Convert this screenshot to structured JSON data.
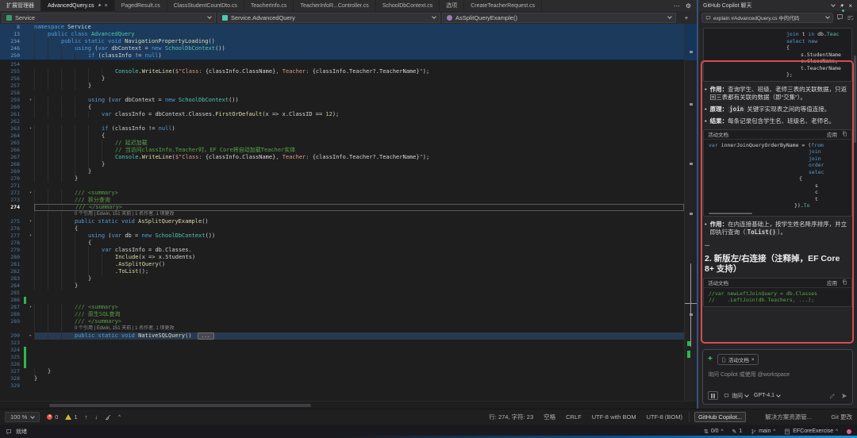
{
  "tabs": {
    "items": [
      {
        "label": "扩展管理器",
        "shade": true
      },
      {
        "label": "AdvancedQuery.cs",
        "active": true,
        "pinned": true,
        "closable": true
      },
      {
        "label": "PagedResult.cs"
      },
      {
        "label": "ClassStudentCountDto.cs"
      },
      {
        "label": "TeacherInfo.cs"
      },
      {
        "label": "TeacherInfoR...Controller.cs"
      },
      {
        "label": "SchoolDbContext.cs"
      },
      {
        "label": "选项"
      },
      {
        "label": "CreateTeacherRequest.cs"
      }
    ],
    "overflow": "⋯"
  },
  "breadcrumb": {
    "project": "Service",
    "type": "Service.AdvancedQuery",
    "member": "AsSplitQueryExample()"
  },
  "editor": {
    "sticky_lines": [
      {
        "n": "8",
        "i": 0,
        "seg": [
          [
            "k",
            "namespace"
          ],
          [
            "p",
            " Service"
          ]
        ]
      },
      {
        "n": "13",
        "i": 1,
        "seg": [
          [
            "k",
            "public"
          ],
          [
            "p",
            " "
          ],
          [
            "k",
            "class"
          ],
          [
            "p",
            " "
          ],
          [
            "t",
            "AdvancedQuery"
          ]
        ]
      },
      {
        "n": "234",
        "i": 2,
        "seg": [
          [
            "k",
            "public"
          ],
          [
            "p",
            " "
          ],
          [
            "k",
            "static"
          ],
          [
            "p",
            " "
          ],
          [
            "k",
            "void"
          ],
          [
            "p",
            " "
          ],
          [
            "m",
            "NavigationPropertyLoading"
          ],
          [
            "p",
            "()"
          ]
        ]
      },
      {
        "n": "246",
        "i": 3,
        "seg": [
          [
            "k",
            "using"
          ],
          [
            "p",
            " ("
          ],
          [
            "k",
            "var"
          ],
          [
            "p",
            " dbContext = "
          ],
          [
            "k",
            "new"
          ],
          [
            "p",
            " "
          ],
          [
            "t",
            "SchoolDbContext"
          ],
          [
            "p",
            "())"
          ]
        ]
      },
      {
        "n": "250",
        "i": 4,
        "seg": [
          [
            "k",
            "if"
          ],
          [
            "p",
            " (classInfo != "
          ],
          [
            "k",
            "null"
          ],
          [
            "p",
            ")"
          ]
        ]
      }
    ],
    "lines": [
      {
        "n": "254",
        "i": 0,
        "seg": []
      },
      {
        "n": "255",
        "i": 6,
        "seg": [
          [
            "t",
            "Console"
          ],
          [
            "p",
            "."
          ],
          [
            "m",
            "WriteLine"
          ],
          [
            "p",
            "("
          ],
          [
            "s",
            "$\"Class: "
          ],
          [
            "p",
            "{classInfo.ClassName}"
          ],
          [
            "s",
            ", Teacher: "
          ],
          [
            "p",
            "{classInfo.Teacher?.TeacherName}"
          ],
          [
            "s",
            "\""
          ],
          [
            "p",
            ");"
          ]
        ]
      },
      {
        "n": "256",
        "i": 5,
        "seg": [
          [
            "p",
            "}"
          ]
        ]
      },
      {
        "n": "257",
        "i": 4,
        "seg": [
          [
            "p",
            "}"
          ]
        ]
      },
      {
        "n": "258",
        "i": 0,
        "seg": []
      },
      {
        "n": "259",
        "i": 4,
        "fold": "v",
        "seg": [
          [
            "k",
            "using"
          ],
          [
            "p",
            " ("
          ],
          [
            "k",
            "var"
          ],
          [
            "p",
            " dbContext = "
          ],
          [
            "k",
            "new"
          ],
          [
            "p",
            " "
          ],
          [
            "t",
            "SchoolDbContext"
          ],
          [
            "p",
            "())"
          ]
        ]
      },
      {
        "n": "260",
        "i": 4,
        "seg": [
          [
            "p",
            "{"
          ]
        ]
      },
      {
        "n": "261",
        "i": 5,
        "seg": [
          [
            "k",
            "var"
          ],
          [
            "p",
            " classInfo = dbContext.Classes."
          ],
          [
            "m",
            "FirstOrDefault"
          ],
          [
            "p",
            "(x => x.ClassID == "
          ],
          [
            "n2",
            "12"
          ],
          [
            "p",
            ");"
          ]
        ]
      },
      {
        "n": "262",
        "i": 0,
        "seg": []
      },
      {
        "n": "263",
        "i": 5,
        "fold": "v",
        "seg": [
          [
            "k",
            "if"
          ],
          [
            "p",
            " (classInfo != "
          ],
          [
            "k",
            "null"
          ],
          [
            "p",
            ")"
          ]
        ]
      },
      {
        "n": "264",
        "i": 5,
        "seg": [
          [
            "p",
            "{"
          ]
        ]
      },
      {
        "n": "265",
        "i": 6,
        "seg": [
          [
            "c",
            "// 延迟加载"
          ]
        ]
      },
      {
        "n": "266",
        "i": 6,
        "seg": [
          [
            "c",
            "// 当访问classInfo.Teacher时，EF Core将自动加载Teacher实体"
          ]
        ]
      },
      {
        "n": "267",
        "i": 6,
        "seg": [
          [
            "t",
            "Console"
          ],
          [
            "p",
            "."
          ],
          [
            "m",
            "WriteLine"
          ],
          [
            "p",
            "("
          ],
          [
            "s",
            "$\"Class: "
          ],
          [
            "p",
            "{classInfo.ClassName}"
          ],
          [
            "s",
            ", Teacher: "
          ],
          [
            "p",
            "{classInfo.Teacher?.TeacherName}"
          ],
          [
            "s",
            "\""
          ],
          [
            "p",
            ");"
          ]
        ]
      },
      {
        "n": "268",
        "i": 5,
        "seg": [
          [
            "p",
            "}"
          ]
        ]
      },
      {
        "n": "269",
        "i": 4,
        "seg": [
          [
            "p",
            "}"
          ]
        ]
      },
      {
        "n": "270",
        "i": 3,
        "seg": [
          [
            "p",
            "}"
          ]
        ]
      },
      {
        "n": "271",
        "i": 0,
        "seg": []
      },
      {
        "n": "272",
        "i": 3,
        "fold": "v",
        "seg": [
          [
            "d",
            "/// <summary>"
          ]
        ]
      },
      {
        "n": "273",
        "i": 3,
        "seg": [
          [
            "d",
            "/// 拆分查询"
          ]
        ]
      },
      {
        "n": "274",
        "i": 3,
        "cur": true,
        "seg": [
          [
            "d",
            "/// </summary>"
          ]
        ]
      },
      {
        "lens": true,
        "i": 3,
        "text": "0 个引用 | Edwin, 151 天前 | 1 名作者, 1 项更改"
      },
      {
        "n": "275",
        "i": 3,
        "fold": "v",
        "seg": [
          [
            "k",
            "public"
          ],
          [
            "p",
            " "
          ],
          [
            "k",
            "static"
          ],
          [
            "p",
            " "
          ],
          [
            "k",
            "void"
          ],
          [
            "p",
            " "
          ],
          [
            "m",
            "AsSplitQueryExample"
          ],
          [
            "p",
            "()"
          ]
        ]
      },
      {
        "n": "276",
        "i": 3,
        "seg": [
          [
            "p",
            "{"
          ]
        ]
      },
      {
        "n": "277",
        "i": 4,
        "fold": "v",
        "seg": [
          [
            "k",
            "using"
          ],
          [
            "p",
            " ("
          ],
          [
            "k",
            "var"
          ],
          [
            "p",
            " db = "
          ],
          [
            "k",
            "new"
          ],
          [
            "p",
            " "
          ],
          [
            "t",
            "SchoolDbContext"
          ],
          [
            "p",
            "())"
          ]
        ]
      },
      {
        "n": "278",
        "i": 4,
        "seg": [
          [
            "p",
            "{"
          ]
        ]
      },
      {
        "n": "279",
        "i": 5,
        "seg": [
          [
            "k",
            "var"
          ],
          [
            "p",
            " classInfo = db.Classes."
          ]
        ]
      },
      {
        "n": "280",
        "i": 6,
        "seg": [
          [
            "m",
            "Include"
          ],
          [
            "p",
            "(x => x.Students)"
          ]
        ]
      },
      {
        "n": "281",
        "i": 6,
        "seg": [
          [
            "p",
            "."
          ],
          [
            "m",
            "AsSplitQuery"
          ],
          [
            "p",
            "()"
          ]
        ]
      },
      {
        "n": "282",
        "i": 6,
        "seg": [
          [
            "p",
            "."
          ],
          [
            "m",
            "ToList"
          ],
          [
            "p",
            "();"
          ]
        ]
      },
      {
        "n": "283",
        "i": 4,
        "seg": [
          [
            "p",
            "}"
          ]
        ]
      },
      {
        "n": "284",
        "i": 3,
        "seg": [
          [
            "p",
            "}"
          ]
        ]
      },
      {
        "n": "285",
        "i": 0,
        "seg": []
      },
      {
        "n": "286",
        "i": 0,
        "chg": true,
        "seg": []
      },
      {
        "n": "287",
        "i": 3,
        "fold": "v",
        "seg": [
          [
            "d",
            "/// <summary>"
          ]
        ]
      },
      {
        "n": "288",
        "i": 3,
        "seg": [
          [
            "d",
            "/// 原生SQL查询"
          ]
        ]
      },
      {
        "n": "289",
        "i": 3,
        "seg": [
          [
            "d",
            "/// </summary>"
          ]
        ]
      },
      {
        "lens": true,
        "i": 3,
        "text": "0 个引用 | Edwin, 151 天前 | 1 名作者, 1 项更改"
      },
      {
        "n": "290",
        "i": 3,
        "fold": ">",
        "hl": true,
        "seg": [
          [
            "k",
            "public"
          ],
          [
            "p",
            " "
          ],
          [
            "k",
            "static"
          ],
          [
            "p",
            " "
          ],
          [
            "k",
            "void"
          ],
          [
            "p",
            " "
          ],
          [
            "m",
            "NativeSQLQuery"
          ],
          [
            "p",
            "() "
          ],
          [
            "box",
            "..."
          ]
        ]
      },
      {
        "n": "323",
        "i": 0,
        "seg": []
      },
      {
        "n": "324",
        "i": 0,
        "chg": true,
        "seg": []
      },
      {
        "n": "325",
        "i": 0,
        "chg": true,
        "seg": []
      },
      {
        "n": "326",
        "i": 0,
        "chg": true,
        "seg": []
      },
      {
        "n": "327",
        "i": 1,
        "seg": [
          [
            "p",
            "}"
          ]
        ]
      },
      {
        "n": "328",
        "i": 0,
        "seg": [
          [
            "p",
            "}"
          ]
        ]
      },
      {
        "n": "329",
        "i": 0,
        "seg": []
      }
    ]
  },
  "copilot": {
    "title": "GitHub Copilot 聊天",
    "prompt": "explain #AdvancedQuery.cs 中的代码",
    "doc_label": "活动文档",
    "apply_label": "应用",
    "blocks": [
      {
        "type": "code",
        "lines": [
          {
            "pad": 100,
            "seg": [
              [
                "k",
                "join"
              ],
              [
                "p",
                " t "
              ],
              [
                "k",
                "in"
              ],
              [
                "p",
                " db."
              ],
              [
                "t",
                "Teac"
              ]
            ]
          },
          {
            "pad": 100,
            "seg": [
              [
                "k",
                "select"
              ],
              [
                "p",
                " "
              ],
              [
                "k",
                "new"
              ]
            ]
          },
          {
            "pad": 100,
            "seg": [
              [
                "p",
                "{"
              ]
            ]
          },
          {
            "pad": 118,
            "seg": [
              [
                "p",
                "s.StudentName"
              ]
            ]
          },
          {
            "pad": 118,
            "seg": [
              [
                "p",
                "c.ClassName,"
              ]
            ]
          },
          {
            "pad": 118,
            "seg": [
              [
                "p",
                "t.TeacherName"
              ]
            ]
          },
          {
            "pad": 100,
            "seg": [
              [
                "p",
                "};"
              ]
            ]
          }
        ]
      },
      {
        "type": "bullet",
        "seg": [
          [
            "b",
            "作用："
          ],
          [
            "t",
            "查询学生、班级、老师三表的关联数据，只返回三表都有关联的数据（即“交集”）。"
          ]
        ]
      },
      {
        "type": "bullet",
        "seg": [
          [
            "b",
            "原理："
          ],
          [
            "code",
            "join"
          ],
          [
            "t",
            " 关键字实现表之间的等值连接。"
          ]
        ]
      },
      {
        "type": "bullet",
        "seg": [
          [
            "b",
            "结果："
          ],
          [
            "t",
            "每条记录包含学生名、班级名、老师名。"
          ]
        ]
      },
      {
        "type": "code",
        "header": true,
        "hscroll": true,
        "lines": [
          {
            "pad": 2,
            "seg": [
              [
                "k",
                "var"
              ],
              [
                "p",
                " innerJoinQueryOrderByName = ("
              ],
              [
                "k",
                "from"
              ]
            ]
          },
          {
            "pad": 128,
            "seg": [
              [
                "k",
                "join"
              ]
            ]
          },
          {
            "pad": 128,
            "seg": [
              [
                "k",
                "join"
              ]
            ]
          },
          {
            "pad": 128,
            "seg": [
              [
                "k",
                "order"
              ]
            ]
          },
          {
            "pad": 128,
            "seg": [
              [
                "k",
                "selec"
              ]
            ]
          },
          {
            "pad": 116,
            "seg": [
              [
                "p",
                "{"
              ]
            ]
          },
          {
            "pad": 136,
            "seg": [
              [
                "p",
                "s"
              ]
            ]
          },
          {
            "pad": 136,
            "seg": [
              [
                "p",
                "c"
              ]
            ]
          },
          {
            "pad": 136,
            "seg": [
              [
                "p",
                "t"
              ]
            ]
          },
          {
            "pad": 110,
            "seg": [
              [
                "p",
                "})."
              ],
              [
                "t",
                "To"
              ]
            ]
          }
        ]
      },
      {
        "type": "bullet",
        "seg": [
          [
            "b",
            "作用："
          ],
          [
            "t",
            "在内连接基础上，按学生姓名降序排序，并立即执行查询（"
          ],
          [
            "code",
            "ToList()"
          ],
          [
            "t",
            "）。"
          ]
        ]
      },
      {
        "type": "ellipsis",
        "text": "..."
      },
      {
        "type": "heading",
        "text": "2. 新版左/右连接（注释掉，EF Core 8+ 支持）"
      },
      {
        "type": "code",
        "header": true,
        "lines": [
          {
            "pad": 2,
            "seg": [
              [
                "c",
                "//var newLeftJoinQuery = db.Classes"
              ]
            ]
          },
          {
            "pad": 2,
            "seg": [
              [
                "c",
                "//    .LeftJoin(db.Teachers, ...);"
              ]
            ]
          }
        ]
      }
    ],
    "input": {
      "context_chip": "活动文档",
      "placeholder": "询问 Copilot 或使用 @workspace",
      "mode": "询问",
      "model": "GPT-4.1"
    }
  },
  "status": {
    "zoom": "100 %",
    "errors": "0",
    "warnings": "1",
    "line_info": "行: 274, 字符: 23",
    "space": "空格",
    "eol": "CRLF",
    "enc1": "UTF-8 with BOM",
    "enc2": "UTF-8 (BOM)",
    "tool_tabs": [
      {
        "label": "GitHub Copilot...",
        "active": true
      },
      {
        "label": "解决方案资源管..."
      },
      {
        "label": "Git 更改"
      }
    ]
  },
  "bottom": {
    "ready": "就绪",
    "sync": "0/0",
    "pending": "1",
    "branch": "main",
    "repo": "EFCoreExercise"
  },
  "colors": {
    "annotation_red": "#d84b4b",
    "change_green": "#2db84d",
    "sticky_blue": "#1b3a5c",
    "keyword_blue": "#569cd6",
    "type_teal": "#4ec9b0",
    "method_yellow": "#dcdcaa",
    "comment_green": "#57a64a"
  }
}
